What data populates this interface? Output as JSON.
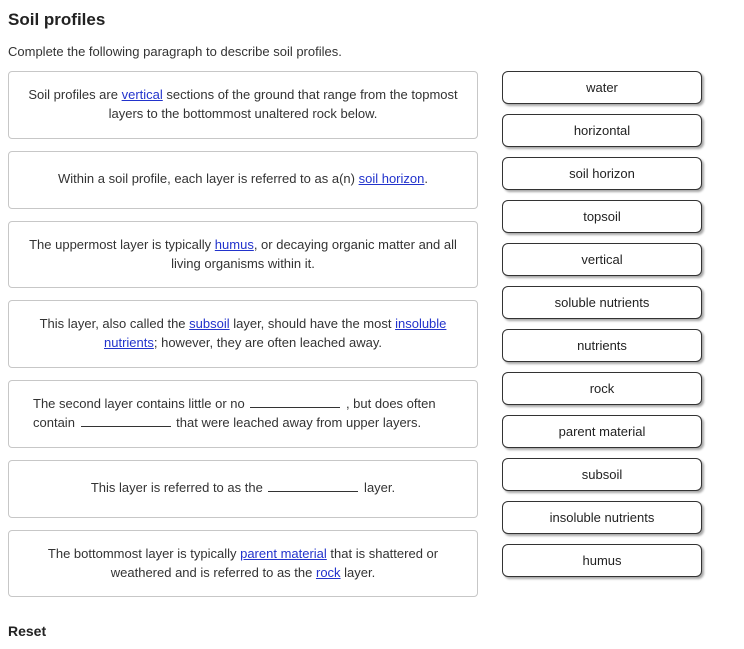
{
  "title": "Soil profiles",
  "instruction": "Complete the following paragraph to describe soil profiles.",
  "sentences": [
    {
      "pre": "Soil profiles are ",
      "fill": "vertical",
      "post": " sections of the ground that range from the topmost layers to the bottommost unaltered rock below."
    },
    {
      "pre": "Within a soil profile, each layer is referred to as a(n) ",
      "fill": "soil horizon",
      "post": "."
    },
    {
      "pre": "The uppermost layer is typically ",
      "fill": "humus",
      "post": ", or decaying organic matter and all living organisms within it."
    },
    {
      "pre1": "This layer, also called the ",
      "fill1": "subsoil",
      "mid1": " layer, should have the most ",
      "fill2": "insoluble nutrients",
      "post1": "; however, they are often leached away."
    },
    {
      "pre": "The second layer contains little or no ",
      "blank1": true,
      "mid": " , but does often contain ",
      "blank2": true,
      "post": " that were leached away from upper layers."
    },
    {
      "pre": "This layer is referred to as the ",
      "blank1": true,
      "post": " layer."
    },
    {
      "pre1": "The bottommost layer is typically ",
      "fill1": "parent material",
      "mid1": " that is shattered or weathered and is referred to as the ",
      "fill2": "rock",
      "post1": " layer."
    }
  ],
  "choices": [
    "water",
    "horizontal",
    "soil horizon",
    "topsoil",
    "vertical",
    "soluble nutrients",
    "nutrients",
    "rock",
    "parent material",
    "subsoil",
    "insoluble nutrients",
    "humus"
  ],
  "reset_label": "Reset"
}
